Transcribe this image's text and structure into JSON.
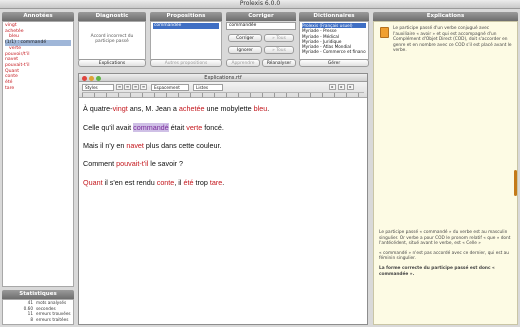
{
  "window": {
    "title": "Prolexis 6.0.0",
    "doc_title": "Explications.rtf"
  },
  "panels": {
    "annotees": {
      "title": "Annotées",
      "words": [
        {
          "text": "vingt",
          "cls": ""
        },
        {
          "text": "achetée",
          "cls": ""
        },
        {
          "text": "bleu",
          "cls": "ind"
        },
        {
          "text": "(1/1) : commandé",
          "cls": "sel"
        },
        {
          "text": "verte",
          "cls": "ind"
        },
        {
          "text": "pouvoir/t'il",
          "cls": ""
        },
        {
          "text": "navet",
          "cls": ""
        },
        {
          "text": "pouvait-t'il",
          "cls": ""
        },
        {
          "text": "Quant",
          "cls": ""
        },
        {
          "text": "conte",
          "cls": ""
        },
        {
          "text": "été",
          "cls": ""
        },
        {
          "text": "tare",
          "cls": ""
        }
      ]
    },
    "diagnostic": {
      "title": "Diagnostic",
      "message": "Accord incorrect du participe passé",
      "button": "Explications"
    },
    "propositions": {
      "title": "Propositions",
      "selected": "commandée",
      "button": "Autres propositions"
    },
    "corriger": {
      "title": "Corriger",
      "field_value": "commandée",
      "btn_correct": "Corriger",
      "btn_ignore": "Ignorer",
      "btn_all1": "» Tous",
      "btn_all2": "» Tous",
      "btn_learn": "Apprendre",
      "btn_reanalyze": "Réanalyser"
    },
    "dictionnaires": {
      "title": "Dictionnaires",
      "entries": [
        {
          "text": "Prolexis (Français usuel)",
          "sel": true
        },
        {
          "text": "Myriade - Presse",
          "sel": false
        },
        {
          "text": "Myriade - Médical",
          "sel": false
        },
        {
          "text": "Myriade - Juridique",
          "sel": false
        },
        {
          "text": "Myriade - Atlas Mondial",
          "sel": false
        },
        {
          "text": "Myriade - Commerce et finance",
          "sel": false
        }
      ],
      "button": "Gérer"
    },
    "explications": {
      "title": "Explications",
      "p1": "Le participe passé d'un verbe conjugué avec l'auxiliaire « avoir » et qui est accompagné d'un Complément d'Objet Direct (COD), doit s'accorder en genre et en nombre avec ce COD s'il est placé avant le verbe.",
      "p2": "Le participe passé « commandé » du verbe est au masculin singulier. Or verbe a pour COD le pronom relatif « que » dont l'antécédent, situé avant le verbe, est « Celle »",
      "p3": "« commandé » n'est pas accordé avec ce dernier, qui est au féminin singulier.",
      "p4": "La forme correcte du participe passé est donc « commandée »."
    }
  },
  "stats": {
    "title": "Statistiques",
    "rows": [
      {
        "n": "41",
        "label": "mots analysés"
      },
      {
        "n": "0.60",
        "label": "secondes"
      },
      {
        "n": "11",
        "label": "erreurs trouvées"
      },
      {
        "n": "8",
        "label": "erreurs traitées"
      }
    ]
  },
  "doc_toolbar": {
    "style": "Styles",
    "spacing": "Espacement",
    "lists": "Listes"
  },
  "document": {
    "lines": [
      [
        {
          "t": "À quatre-",
          "c": ""
        },
        {
          "t": "vingt",
          "c": "r"
        },
        {
          "t": " ans, M. Jean a ",
          "c": ""
        },
        {
          "t": "achetée",
          "c": "r"
        },
        {
          "t": " une mobylette ",
          "c": ""
        },
        {
          "t": "bleu",
          "c": "r"
        },
        {
          "t": ".",
          "c": ""
        }
      ],
      [
        {
          "t": "Celle qu'il avait ",
          "c": ""
        },
        {
          "t": "commandé",
          "c": "hl"
        },
        {
          "t": " était ",
          "c": ""
        },
        {
          "t": "verte",
          "c": "r"
        },
        {
          "t": " foncé.",
          "c": ""
        }
      ],
      [
        {
          "t": "Mais il n'y en ",
          "c": ""
        },
        {
          "t": "navet",
          "c": "r"
        },
        {
          "t": " plus dans cette couleur.",
          "c": ""
        }
      ],
      [
        {
          "t": "Comment ",
          "c": ""
        },
        {
          "t": "pouvait-t'il",
          "c": "r"
        },
        {
          "t": " le savoir ?",
          "c": ""
        }
      ],
      [
        {
          "t": "Quant",
          "c": "r"
        },
        {
          "t": " il s'en est rendu ",
          "c": ""
        },
        {
          "t": "conte",
          "c": "r"
        },
        {
          "t": ", il ",
          "c": ""
        },
        {
          "t": "été",
          "c": "r"
        },
        {
          "t": " trop ",
          "c": ""
        },
        {
          "t": "tare",
          "c": "r"
        },
        {
          "t": ".",
          "c": ""
        }
      ]
    ]
  },
  "colors": {
    "error": "#c4161c",
    "highlight": "#cfc0e6",
    "accent": "#3f6fc4",
    "expl_bg": "#fdfbe4"
  }
}
